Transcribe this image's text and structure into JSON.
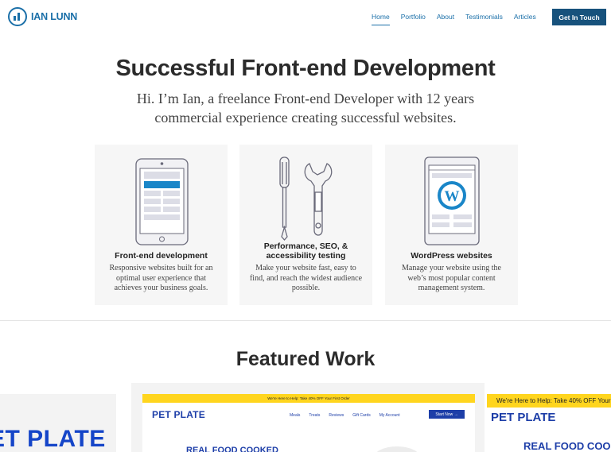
{
  "header": {
    "logo_text": "IAN LUNN",
    "nav": [
      {
        "label": "Home",
        "active": true
      },
      {
        "label": "Portfolio",
        "active": false
      },
      {
        "label": "About",
        "active": false
      },
      {
        "label": "Testimonials",
        "active": false
      },
      {
        "label": "Articles",
        "active": false
      }
    ],
    "cta_label": "Get In Touch"
  },
  "hero": {
    "title": "Successful Front-end Development",
    "subtitle": "Hi. I’m Ian, a freelance Front-end Developer with 12 years commercial experience creating successful websites."
  },
  "services": [
    {
      "icon": "tablet-icon",
      "title": "Front-end development",
      "desc": "Responsive websites built for an optimal user experience that achieves your business goals."
    },
    {
      "icon": "tools-icon",
      "title": "Performance, SEO, & accessibility testing",
      "desc": "Make your website fast, easy to find, and reach the widest audience possible."
    },
    {
      "icon": "wordpress-icon",
      "title": "WordPress websites",
      "desc": "Manage your website using the web’s most popular content management system."
    }
  ],
  "featured": {
    "title": "Featured Work",
    "left_preview": {
      "text": "ET PLATE"
    },
    "center_preview": {
      "banner": "We're Here to Help: Take 40% OFF Your First Order",
      "brand": "PET PLATE",
      "nav": [
        "Meals",
        "Treats",
        "Reviews",
        "Gift Cards",
        "My Account"
      ],
      "button": "Start Now →",
      "headline": "REAL FOOD COOKED"
    },
    "right_preview": {
      "banner": "We're Here to Help: Take 40% OFF Your F",
      "brand": "PET PLATE",
      "headline": "REAL FOOD COOKE"
    }
  },
  "colors": {
    "primary": "#1a6fa8",
    "cta": "#17527c",
    "brand_blue": "#1d3ea8",
    "banner_yellow": "#ffd51e"
  }
}
